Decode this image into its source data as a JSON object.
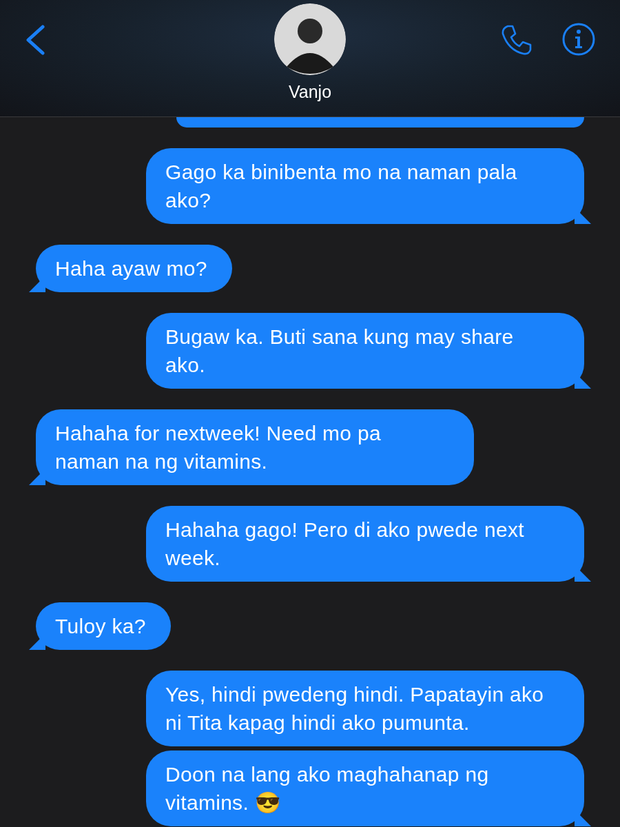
{
  "header": {
    "contact_name": "Vanjo"
  },
  "messages": [
    {
      "kind": "sent",
      "text": "Gago ka binibenta mo na naman pala ako?",
      "tail": true
    },
    {
      "kind": "received",
      "text": "Haha ayaw mo?",
      "tail": true
    },
    {
      "kind": "sent",
      "text": "Bugaw ka. Buti sana kung may share ako.",
      "tail": true
    },
    {
      "kind": "received",
      "text": "Hahaha for nextweek! Need mo pa naman na ng vitamins.",
      "tail": true
    },
    {
      "kind": "sent",
      "text": "Hahaha gago! Pero di ako pwede next week.",
      "tail": true
    },
    {
      "kind": "received",
      "text": "Tuloy ka?",
      "tail": true
    },
    {
      "kind": "sent",
      "text": "Yes, hindi pwedeng hindi. Papatayin ako ni Tita kapag hindi ako pumunta.",
      "tail": false
    },
    {
      "kind": "sent",
      "text": "Doon na lang ako maghahanap ng vitamins. 😎",
      "tail": true
    }
  ]
}
